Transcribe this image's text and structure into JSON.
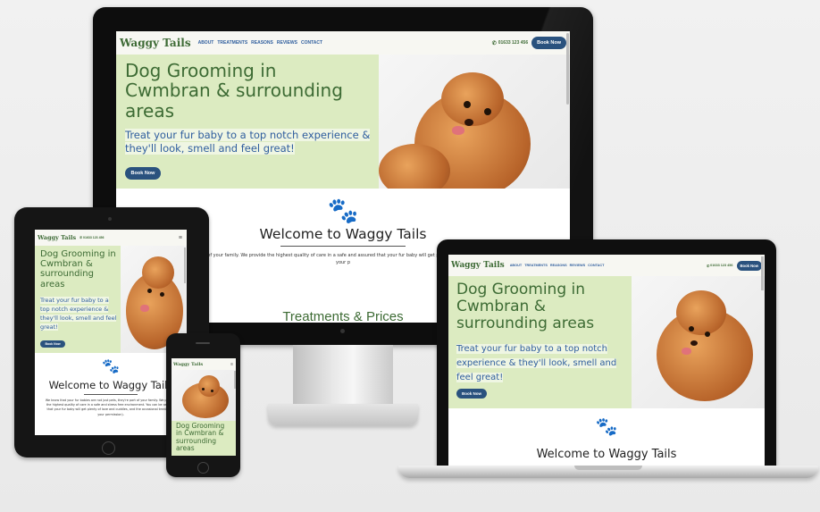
{
  "brand": "Waggy Tails",
  "nav": {
    "items": [
      "ABOUT",
      "TREATMENTS",
      "REASONS",
      "REVIEWS",
      "CONTACT"
    ],
    "phone": "01633 123 456",
    "book_label": "Book Now",
    "menu_icon": "hamburger-icon"
  },
  "hero": {
    "title_monitor": "Dog Grooming in Cwmbran & surrounding areas",
    "title_tablet": "Dog Grooming in Cwmbran & surrounding areas",
    "title_phone": "Dog Grooming in Cwmbran & surrounding areas",
    "title_laptop": "Dog Grooming in Cwmbran & surrounding areas",
    "subtitle": "Treat your fur baby to a top notch experience & they'll look, smell and feel great!",
    "button": "Book Now"
  },
  "welcome": {
    "title": "Welcome to Waggy Tails",
    "paragraph_monitor": "r babies are not just pets, they're part of your family. We provide the highest quality of care in a safe and  assured that your fur baby will get plenty of love and cuddles, and the occasional treat (with your p",
    "paragraph_tablet": "We know that your fur babies are not just pets, they're part of your family. We provide the highest quality of care in a safe and stress free environment. You can be assured that your fur baby will get plenty of love and cuddles, and the occasional treat (with your permission).",
    "partial_heading_monitor": "Treatments & Prices",
    "partial_heading_laptop": "Welcome to Waggy Tails"
  },
  "colors": {
    "brand_green": "#3e6b36",
    "hero_bg": "#dcebc1",
    "link_blue": "#2f5e9e",
    "button_bg": "#2a527e"
  }
}
